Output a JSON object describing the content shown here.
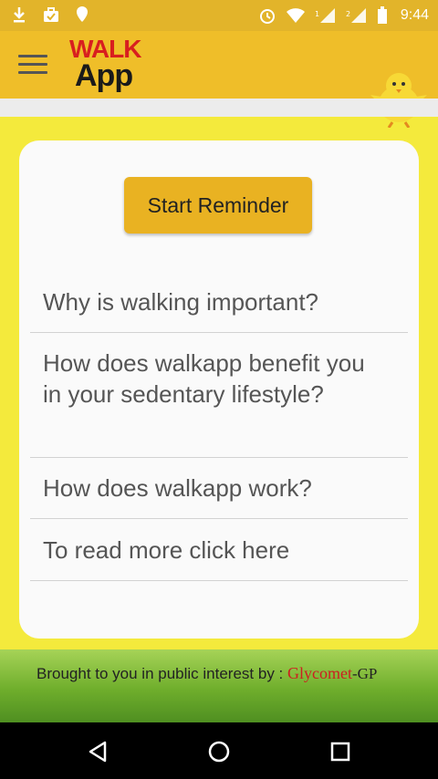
{
  "status_bar": {
    "time": "9:44",
    "left_icons": [
      "download-icon",
      "briefcase-icon",
      "location-icon"
    ],
    "right_icons": [
      "alarm-icon",
      "wifi-icon",
      "signal-icon",
      "signal-icon",
      "battery-icon"
    ]
  },
  "app_bar": {
    "logo_line1": "WALK",
    "logo_line2": "App",
    "menu_icon": "hamburger-icon",
    "mascot_icon": "chick-mascot-icon"
  },
  "card": {
    "start_button": "Start Reminder",
    "items": [
      "Why is walking important?",
      "How does walkapp benefit you in your sedentary lifestyle?",
      "How does walkapp work?",
      "To read more click here"
    ]
  },
  "footer": {
    "credit_text": "Brought to you in public interest  by : ",
    "brand": "Glycomet",
    "brand_suffix": "-GP"
  },
  "nav_bar": {
    "icons": [
      "back-icon",
      "home-icon",
      "recents-icon"
    ]
  },
  "colors": {
    "status_bar": "#e2b42a",
    "app_bar": "#efbe29",
    "page_bg": "#f4ea3c",
    "button": "#e9b222",
    "brand": "#cc2020"
  }
}
